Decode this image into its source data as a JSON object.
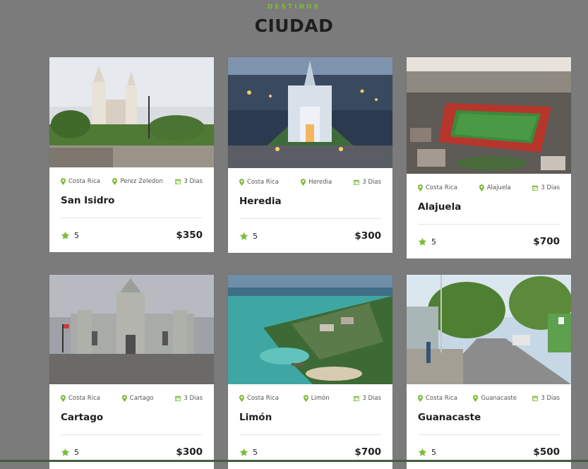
{
  "section": {
    "eyebrow": "DESTINOS",
    "title": "CIUDAD"
  },
  "colors": {
    "accent": "#7cbd3a",
    "overlay": "#7b7b7b",
    "text": "#1e1e1e"
  },
  "cards": [
    {
      "country": "Costa Rica",
      "region": "Perez Zeledon",
      "duration": "3 Dias",
      "name": "San Isidro",
      "rating": "5",
      "price": "$350",
      "image": "church-twin-towers-plaza"
    },
    {
      "country": "Costa Rica",
      "region": "Heredia",
      "duration": "3 Dias",
      "name": "Heredia",
      "rating": "5",
      "price": "$300",
      "image": "church-illuminated-night"
    },
    {
      "country": "Costa Rica",
      "region": "Alajuela",
      "duration": "3 Dias",
      "name": "Alajuela",
      "rating": "5",
      "price": "$700",
      "image": "stadium-aerial"
    },
    {
      "country": "Costa Rica",
      "region": "Cartago",
      "duration": "3 Dias",
      "name": "Cartago",
      "rating": "5",
      "price": "$300",
      "image": "basilica-cloudy"
    },
    {
      "country": "Costa Rica",
      "region": "Limón",
      "duration": "3 Dias",
      "name": "Limón",
      "rating": "5",
      "price": "$700",
      "image": "coastal-aerial"
    },
    {
      "country": "Costa Rica",
      "region": "Guanacaste",
      "duration": "3 Dias",
      "name": "Guanacaste",
      "rating": "5",
      "price": "$500",
      "image": "town-street"
    }
  ]
}
